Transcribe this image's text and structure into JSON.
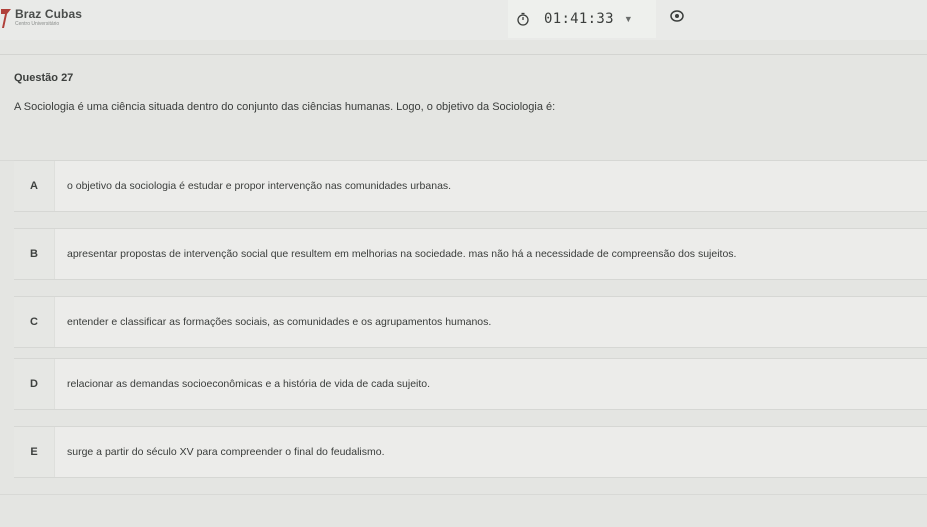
{
  "header": {
    "brand_name": "Braz Cubas",
    "brand_subtitle": "Centro Universitário",
    "timer": "01:41:33",
    "timer_icon": "stopwatch-icon",
    "toggle_icon": "chevron-down-icon",
    "visibility_icon": "eye-icon"
  },
  "question": {
    "number_label": "Questão 27",
    "prompt": "A Sociologia é uma ciência situada dentro do conjunto das ciências humanas. Logo,  o objetivo da Sociologia é:"
  },
  "options": [
    {
      "letter": "A",
      "text": "o objetivo da sociologia é estudar e propor intervenção nas comunidades urbanas."
    },
    {
      "letter": "B",
      "text": "apresentar propostas de intervenção social que resultem em melhorias na sociedade. mas não há a necessidade de compreensão dos sujeitos."
    },
    {
      "letter": "C",
      "text": "entender e classificar as formações sociais, as comunidades e os agrupamentos humanos."
    },
    {
      "letter": "D",
      "text": "relacionar as demandas socioeconômicas e a história de vida de cada sujeito."
    },
    {
      "letter": "E",
      "text": "surge a partir do século XV para compreender o final do feudalismo."
    }
  ],
  "colors": {
    "background": "#e4e5e2",
    "option_background": "#ececea",
    "text": "#3a3d3b",
    "logo_accent": "#b0403a"
  }
}
